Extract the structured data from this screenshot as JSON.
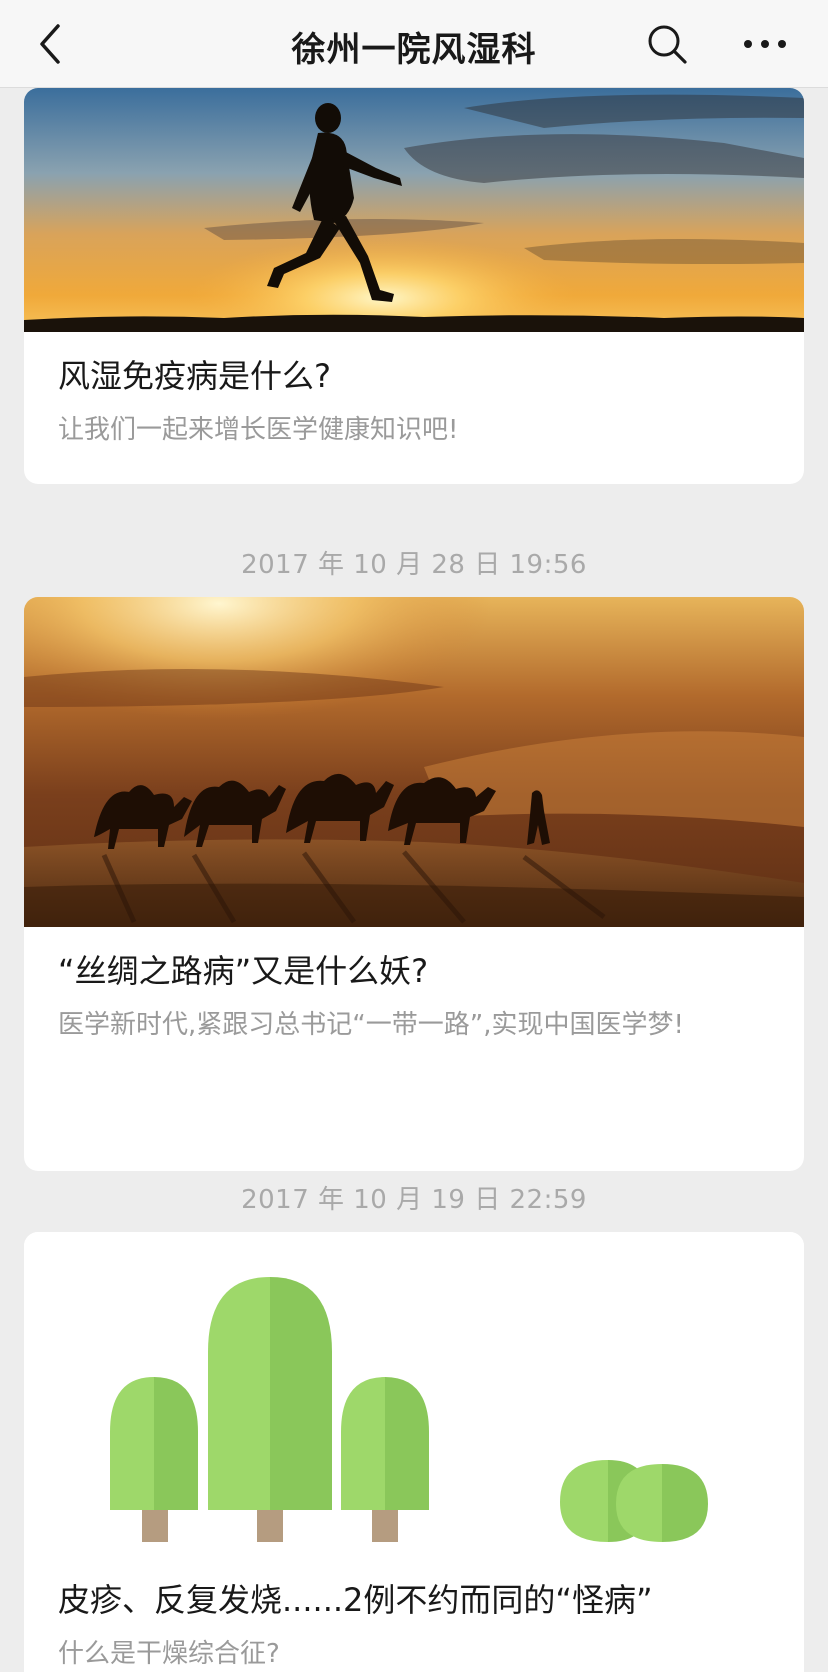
{
  "navbar": {
    "title": "徐州一院风湿科",
    "back_icon": "chevron-left-icon",
    "search_icon": "search-icon",
    "more_icon": "more-dots-icon"
  },
  "articles": [
    {
      "title": "风湿免疫病是什么?",
      "digest": "让我们一起来增长医学健康知识吧!",
      "cover": "runner-sunset-image"
    },
    {
      "timestamp": "2017 年 10 月 28 日  19:56",
      "title": "“丝绸之路病”又是什么妖?",
      "digest": "医学新时代,紧跟习总书记“一带一路”,实现中国医学梦!",
      "cover": "camel-caravan-desert-image"
    },
    {
      "timestamp": "2017 年 10 月 19 日  22:59",
      "title": "皮疹、反复发烧......2例不约而同的“怪病”",
      "digest": "什么是干燥综合征?",
      "cover": "green-trees-illustration"
    }
  ],
  "colors": {
    "page_background": "#ededed",
    "card_background": "#ffffff",
    "title_text": "#191919",
    "digest_text": "#9a9a9a",
    "timestamp_text": "#a9a9a9",
    "tree_light": "#9ed86a",
    "tree_dark": "#8ac75a",
    "trunk": "#b59c80"
  }
}
